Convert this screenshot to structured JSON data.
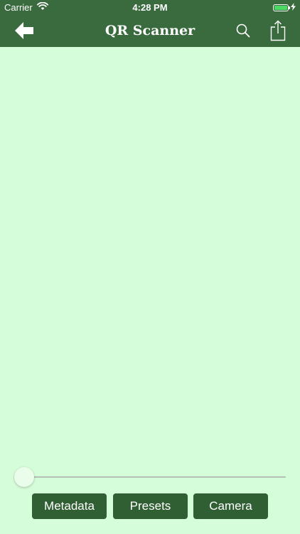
{
  "status_bar": {
    "carrier": "Carrier",
    "time": "4:28 PM",
    "battery_level": 1.0
  },
  "nav_bar": {
    "title": "QR Scanner",
    "back_icon": "back-arrow-icon",
    "search_icon": "search-icon",
    "share_icon": "share-icon"
  },
  "slider": {
    "value": 0.0
  },
  "actions": {
    "metadata_label": "Metadata",
    "presets_label": "Presets",
    "camera_label": "Camera"
  },
  "colors": {
    "bar": "#3a6b3e",
    "background": "#d6fdd9",
    "button": "#2f5f33"
  }
}
